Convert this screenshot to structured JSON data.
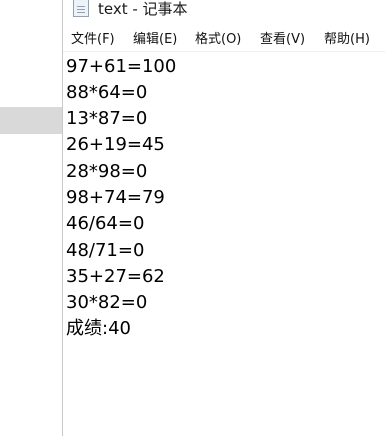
{
  "window": {
    "title": "text - 记事本"
  },
  "menu": [
    {
      "label": "文件(F)"
    },
    {
      "label": "编辑(E)"
    },
    {
      "label": "格式(O)"
    },
    {
      "label": "查看(V)"
    },
    {
      "label": "帮助(H)"
    }
  ],
  "document": {
    "lines": [
      "97+61=100",
      "88*64=0",
      "13*87=0",
      "26+19=45",
      "28*98=0",
      "98+74=79",
      "46/64=0",
      "48/71=0",
      "35+27=62",
      "30*82=0",
      "成绩:40"
    ]
  },
  "icons": {
    "app": "notepad-icon"
  }
}
